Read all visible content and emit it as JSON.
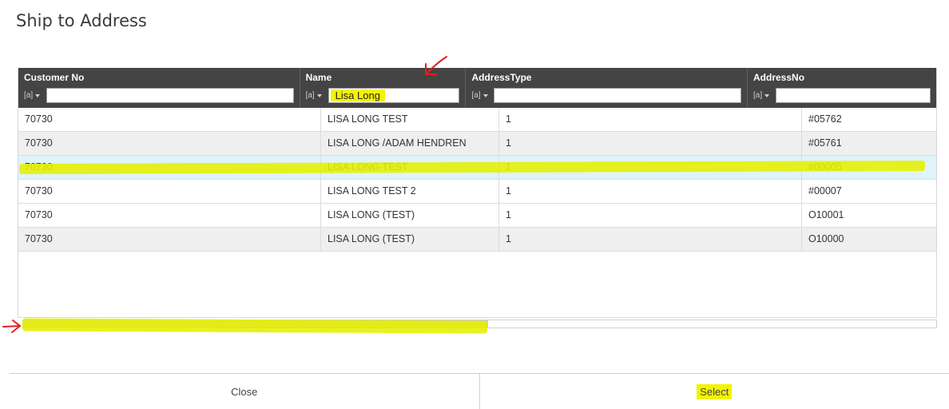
{
  "dialog": {
    "title": "Ship to Address"
  },
  "grid": {
    "columns": [
      {
        "label": "Customer No",
        "filter_value": ""
      },
      {
        "label": "Name",
        "filter_value": "Lisa Long"
      },
      {
        "label": "AddressType",
        "filter_value": ""
      },
      {
        "label": "AddressNo",
        "filter_value": ""
      }
    ],
    "filter_toggle_glyph": "[a]",
    "rows": [
      {
        "customer_no": "70730",
        "name": "LISA LONG TEST",
        "address_type": "1",
        "address_no": "#05762"
      },
      {
        "customer_no": "70730",
        "name": "LISA LONG /ADAM HENDREN",
        "address_type": "1",
        "address_no": "#05761"
      },
      {
        "customer_no": "70730",
        "name": "LISA LONG TEST",
        "address_type": "1",
        "address_no": "#00005"
      },
      {
        "customer_no": "70730",
        "name": "LISA LONG TEST 2",
        "address_type": "1",
        "address_no": "#00007"
      },
      {
        "customer_no": "70730",
        "name": "LISA LONG (TEST)",
        "address_type": "1",
        "address_no": "O10001"
      },
      {
        "customer_no": "70730",
        "name": "LISA LONG (TEST)",
        "address_type": "1",
        "address_no": "O10000"
      }
    ],
    "selected_row": 2
  },
  "footer": {
    "close_label": "Close",
    "select_label": "Select"
  },
  "colors": {
    "header_bg": "#444444",
    "highlight": "#f3f300",
    "selected_row": "#dff3fa",
    "annotation_arrow": "#e02020"
  }
}
